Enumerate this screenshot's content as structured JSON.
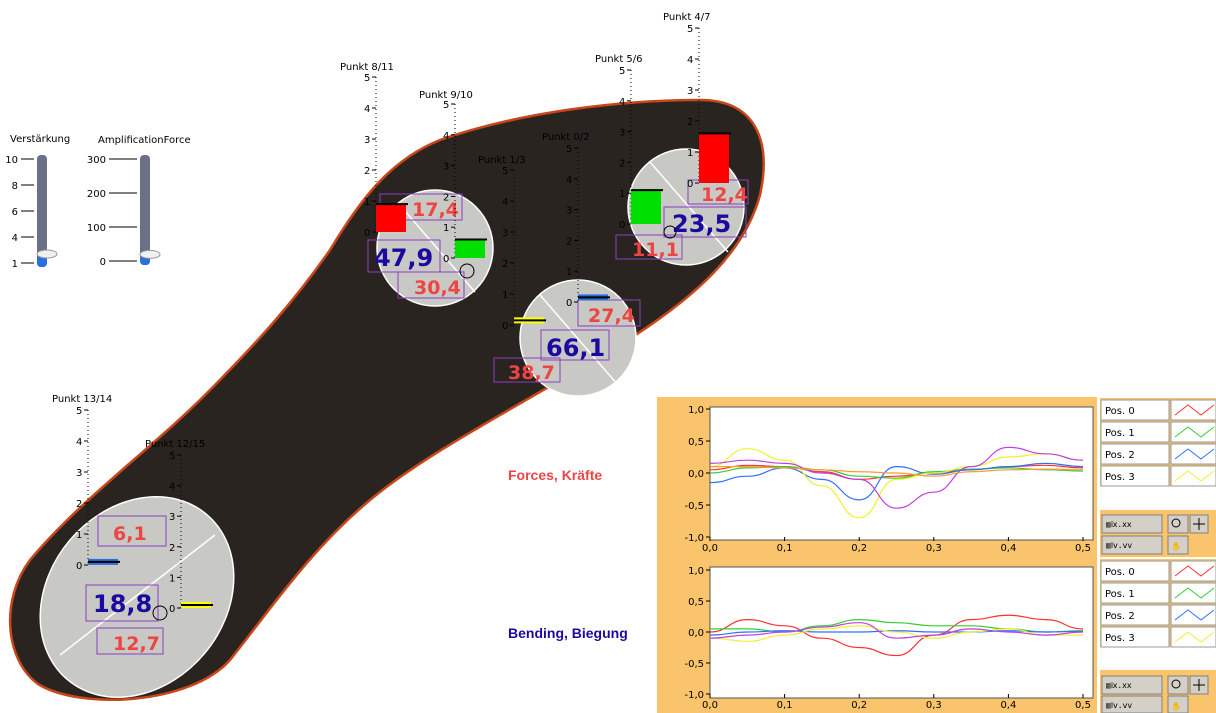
{
  "colors": {
    "sole": "#2a2420",
    "sole_border": "#c8461a",
    "sensor_disc": "#c8c8c4",
    "red_value": "#ee4444",
    "blue_value": "#1a0aa0",
    "chart_frame": "#f9c46b",
    "bar_red": "#ff0000",
    "bar_green": "#00e000",
    "bar_blue": "#2a6fdc",
    "bar_yellow": "#ffff00"
  },
  "sliders": [
    {
      "title": "Verstärkung",
      "ticks": [
        "10",
        "8",
        "6",
        "4",
        "1"
      ],
      "fraction": 0.08
    },
    {
      "title": "AmplificationForce",
      "ticks": [
        "300",
        "200",
        "100",
        "0"
      ],
      "fraction": 0.06
    }
  ],
  "sensors": [
    {
      "id": "heel",
      "force_a": "6,1",
      "bending": "18,8",
      "force_b": "12,7"
    },
    {
      "id": "mid",
      "force_a": "27,4",
      "bending": "66,1",
      "force_b": "38,7"
    },
    {
      "id": "left",
      "force_a": "17,4",
      "bending": "47,9",
      "force_b": "30,4"
    },
    {
      "id": "toe",
      "force_a": "12,4",
      "bending": "23,5",
      "force_b": "11,1"
    }
  ],
  "gauges": [
    {
      "label": "Punkt 13/14",
      "ticks": [
        "5",
        "4",
        "3",
        "2",
        "1",
        "0"
      ],
      "value": 0.1,
      "color": "#2a6fdc"
    },
    {
      "label": "Punkt 12/15",
      "ticks": [
        "5",
        "4",
        "3",
        "2",
        "1",
        "0"
      ],
      "value": 0.1,
      "color": "#ffff00"
    },
    {
      "label": "Punkt 8/11",
      "ticks": [
        "5",
        "4",
        "3",
        "2",
        "1",
        "0"
      ],
      "value": 0.9,
      "color": "#ff0000"
    },
    {
      "label": "Punkt 9/10",
      "ticks": [
        "5",
        "4",
        "3",
        "2",
        "1",
        "0"
      ],
      "value": 0.6,
      "color": "#00e000"
    },
    {
      "label": "Punkt 1/3",
      "ticks": [
        "5",
        "4",
        "3",
        "2",
        "1",
        "0"
      ],
      "value": 0.15,
      "color": "#ffff00"
    },
    {
      "label": "Punkt 0/2",
      "ticks": [
        "5",
        "4",
        "3",
        "2",
        "1",
        "0"
      ],
      "value": 0.15,
      "color": "#2a6fdc"
    },
    {
      "label": "Punkt 5/6",
      "ticks": [
        "5",
        "4",
        "3",
        "2",
        "1",
        "0"
      ],
      "value": 1.1,
      "color": "#00e000"
    },
    {
      "label": "Punkt 4/7",
      "ticks": [
        "5",
        "4",
        "3",
        "2",
        "1",
        "0"
      ],
      "value": 1.6,
      "color": "#ff0000"
    }
  ],
  "charts": {
    "forces_label": "Forces, Kräfte",
    "bending_label": "Bending, Biegung",
    "legend": [
      "Pos. 0",
      "Pos. 1",
      "Pos. 2",
      "Pos. 3"
    ],
    "legend_colors": [
      "#ff3030",
      "#30d030",
      "#3070ff",
      "#f0f030"
    ]
  },
  "chart_data": [
    {
      "type": "line",
      "title": "Forces, Kräfte",
      "xlim": [
        0,
        0.5
      ],
      "ylim": [
        -1,
        1
      ],
      "xticks": [
        "0,0",
        "0,1",
        "0,2",
        "0,3",
        "0,4",
        "0,5"
      ],
      "yticks": [
        "1,0",
        "0,5",
        "0,0",
        "-0,5",
        "-1,0"
      ],
      "grid": false,
      "x": [
        0,
        0.05,
        0.1,
        0.15,
        0.2,
        0.25,
        0.3,
        0.35,
        0.4,
        0.45,
        0.5
      ],
      "series": [
        {
          "name": "Pos. 0",
          "color": "#ff3030",
          "values": [
            0.05,
            0.12,
            0.1,
            0.02,
            -0.1,
            -0.05,
            0.0,
            0.05,
            0.1,
            0.12,
            0.08
          ]
        },
        {
          "name": "Pos. 1",
          "color": "#30d030",
          "values": [
            0.0,
            0.08,
            0.1,
            0.05,
            -0.05,
            -0.08,
            0.02,
            0.06,
            0.08,
            0.05,
            0.03
          ]
        },
        {
          "name": "Pos. 2",
          "color": "#3070ff",
          "values": [
            -0.15,
            -0.05,
            0.08,
            -0.1,
            -0.42,
            0.1,
            -0.02,
            0.05,
            0.1,
            0.15,
            0.1
          ]
        },
        {
          "name": "Pos. 3",
          "color": "#f0f030",
          "values": [
            0.1,
            0.38,
            0.2,
            -0.2,
            -0.7,
            -0.1,
            0.0,
            0.1,
            0.25,
            0.3,
            0.2
          ]
        },
        {
          "name": "",
          "color": "#c040e0",
          "values": [
            0.15,
            0.2,
            0.15,
            0.0,
            -0.1,
            -0.55,
            -0.3,
            0.1,
            0.4,
            0.3,
            0.2
          ]
        },
        {
          "name": "",
          "color": "#ff9933",
          "values": [
            0.1,
            0.1,
            0.08,
            0.05,
            0.02,
            0.0,
            -0.05,
            0.02,
            0.05,
            0.06,
            0.05
          ]
        }
      ]
    },
    {
      "type": "line",
      "title": "Bending, Biegung",
      "xlim": [
        0,
        0.5
      ],
      "ylim": [
        -1,
        1
      ],
      "xticks": [
        "0,0",
        "0,1",
        "0,2",
        "0,3",
        "0,4",
        "0,5"
      ],
      "yticks": [
        "1,0",
        "0,5",
        "0,0",
        "-0,5",
        "-1,0"
      ],
      "grid": false,
      "x": [
        0,
        0.05,
        0.1,
        0.15,
        0.2,
        0.25,
        0.3,
        0.35,
        0.4,
        0.45,
        0.5
      ],
      "series": [
        {
          "name": "Pos. 0",
          "color": "#ff3030",
          "values": [
            0.0,
            0.2,
            0.1,
            -0.1,
            -0.25,
            -0.38,
            -0.05,
            0.2,
            0.27,
            0.2,
            0.05
          ]
        },
        {
          "name": "Pos. 1",
          "color": "#30d030",
          "values": [
            0.05,
            0.05,
            0.0,
            0.1,
            0.2,
            0.15,
            0.1,
            0.1,
            0.05,
            0.0,
            0.02
          ]
        },
        {
          "name": "Pos. 2",
          "color": "#3070ff",
          "values": [
            -0.05,
            0.0,
            0.02,
            0.0,
            0.0,
            0.02,
            0.0,
            0.0,
            0.02,
            0.0,
            0.01
          ]
        },
        {
          "name": "Pos. 3",
          "color": "#f0f030",
          "values": [
            -0.1,
            -0.15,
            -0.05,
            0.05,
            0.1,
            0.0,
            -0.1,
            0.0,
            0.05,
            -0.05,
            -0.05
          ]
        },
        {
          "name": "",
          "color": "#c040e0",
          "values": [
            -0.1,
            -0.05,
            0.0,
            0.08,
            0.15,
            -0.1,
            -0.05,
            0.05,
            0.0,
            -0.05,
            0.0
          ]
        }
      ]
    }
  ]
}
